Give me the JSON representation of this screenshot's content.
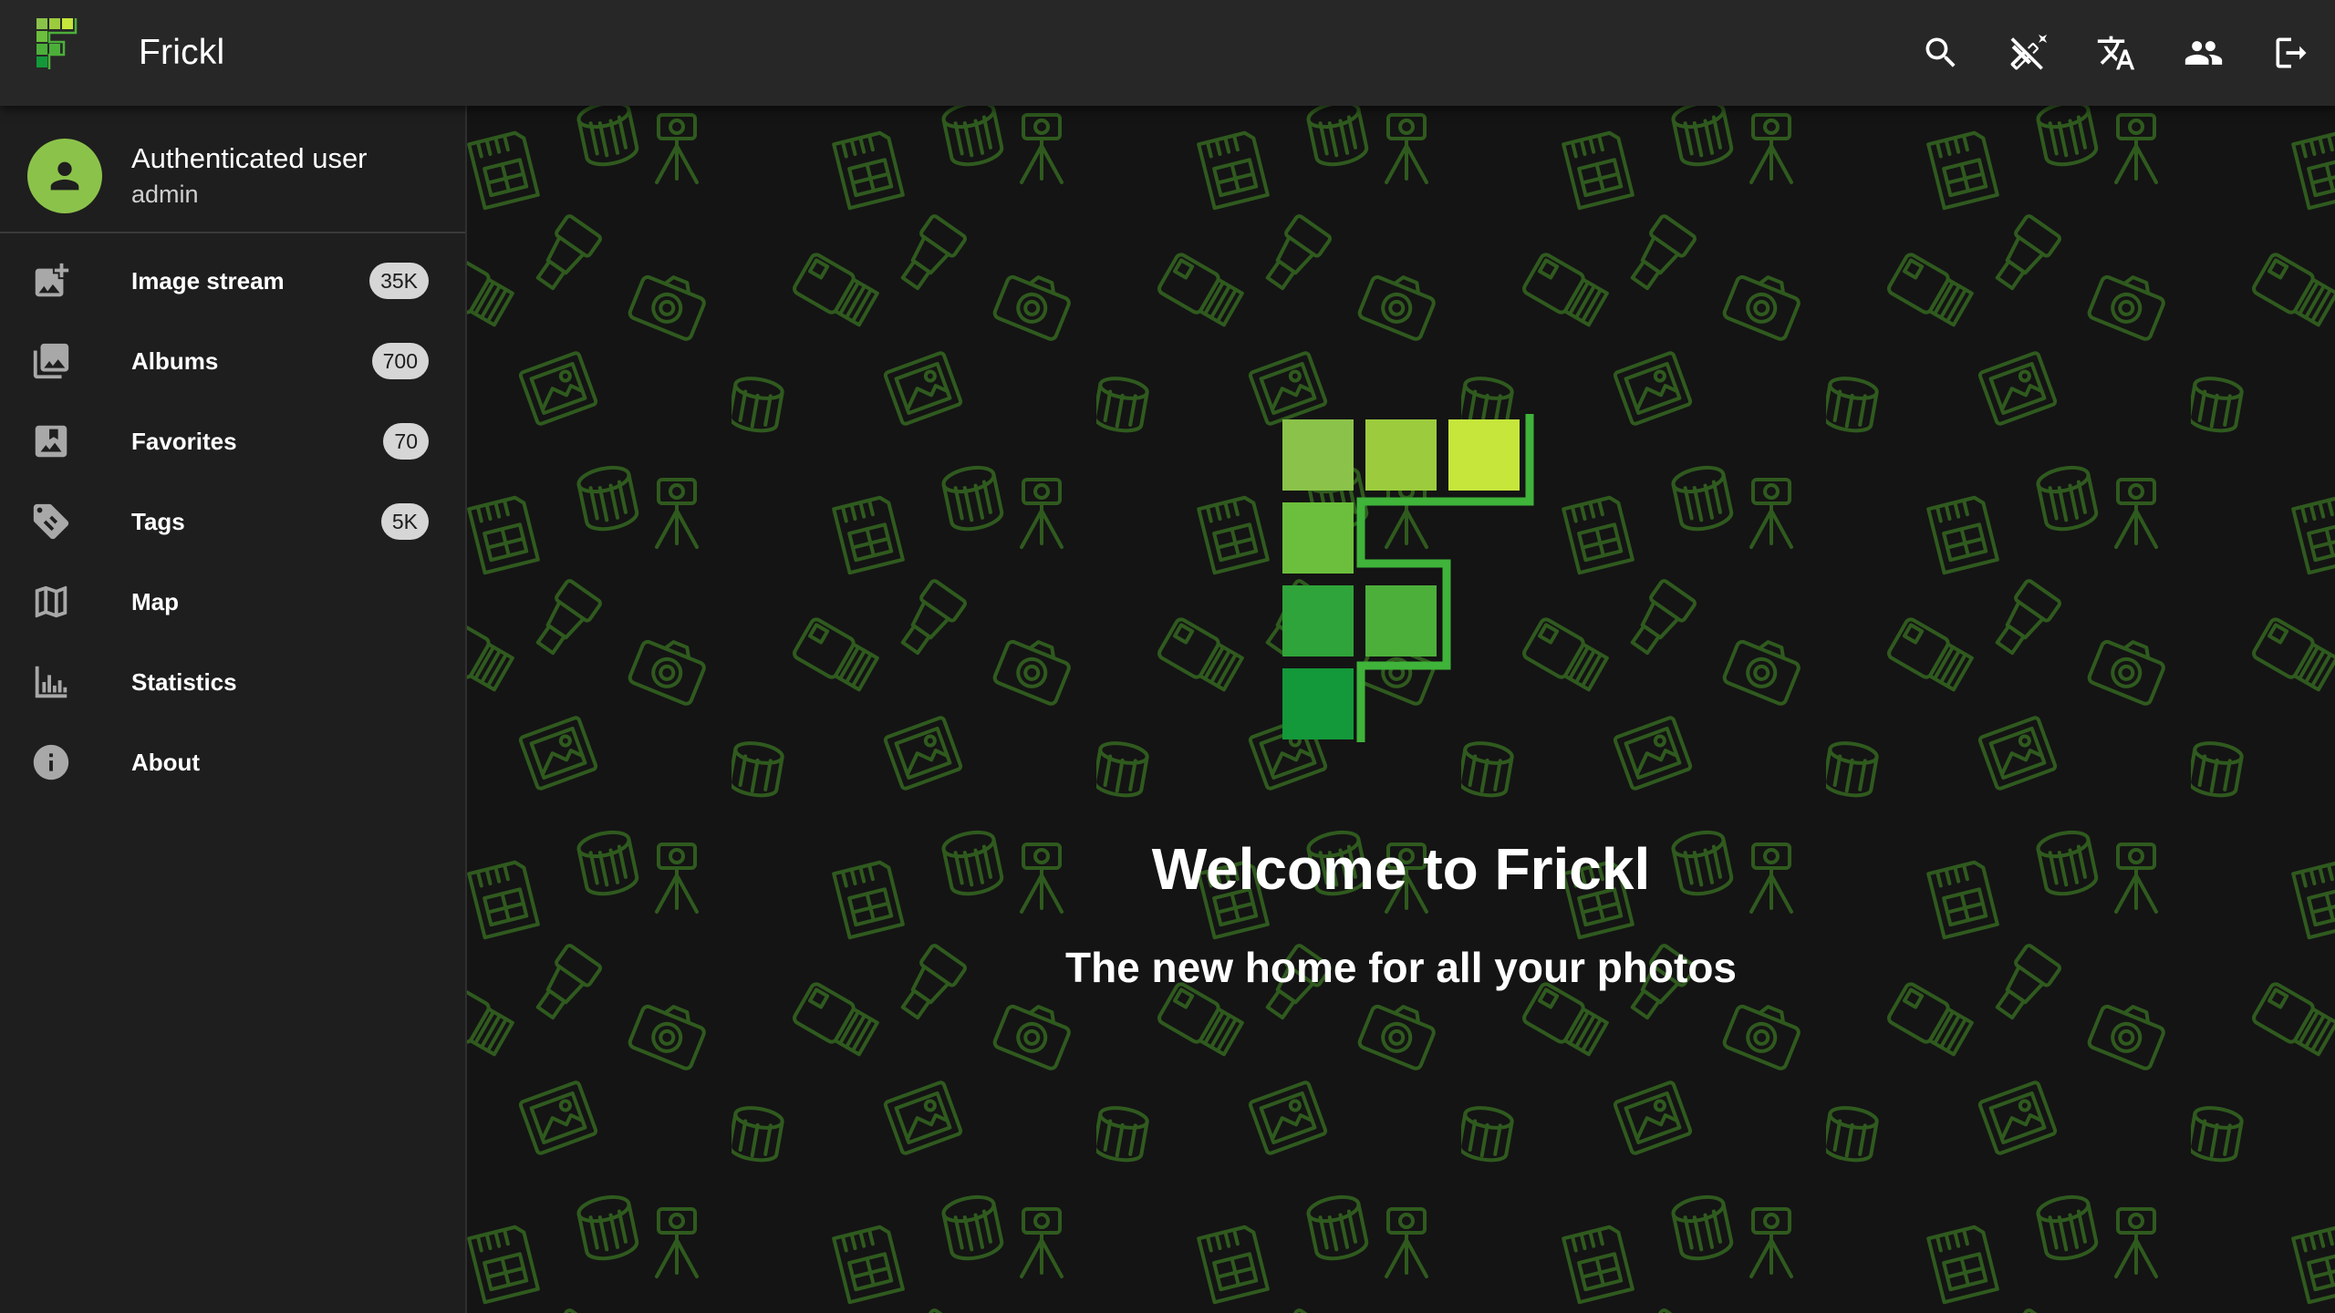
{
  "app": {
    "title": "Frickl",
    "logo_icon": "frickl-logo-icon"
  },
  "header": {
    "actions": [
      {
        "name": "search",
        "icon": "search-icon"
      },
      {
        "name": "dark-mode-toggle",
        "icon": "auto-fix-off-icon"
      },
      {
        "name": "language",
        "icon": "translate-icon"
      },
      {
        "name": "users",
        "icon": "people-icon"
      },
      {
        "name": "logout",
        "icon": "logout-icon"
      }
    ]
  },
  "user": {
    "name": "Authenticated user",
    "role": "admin",
    "avatar_icon": "person-icon"
  },
  "sidebar": {
    "items": [
      {
        "label": "Image stream",
        "badge": "35K",
        "icon": "add-photo-icon"
      },
      {
        "label": "Albums",
        "badge": "700",
        "icon": "photo-library-icon"
      },
      {
        "label": "Favorites",
        "badge": "70",
        "icon": "bookmark-image-icon"
      },
      {
        "label": "Tags",
        "badge": "5K",
        "icon": "tag-icon"
      },
      {
        "label": "Map",
        "icon": "map-icon"
      },
      {
        "label": "Statistics",
        "icon": "bar-chart-icon"
      },
      {
        "label": "About",
        "icon": "info-icon"
      }
    ]
  },
  "main": {
    "title": "Welcome to Frickl",
    "subtitle": "The new home for all your photos"
  },
  "colors": {
    "appbar": "#272727",
    "sidebar": "#1e1e1e",
    "background": "#141414",
    "accent": "#8bc34a",
    "pattern": "#2f5a1e",
    "logo_greens": [
      "#8bc34a",
      "#9ccc3d",
      "#c6e63b",
      "#6cbf3c",
      "#4caf3a",
      "#2fa43a",
      "#13983a"
    ]
  }
}
